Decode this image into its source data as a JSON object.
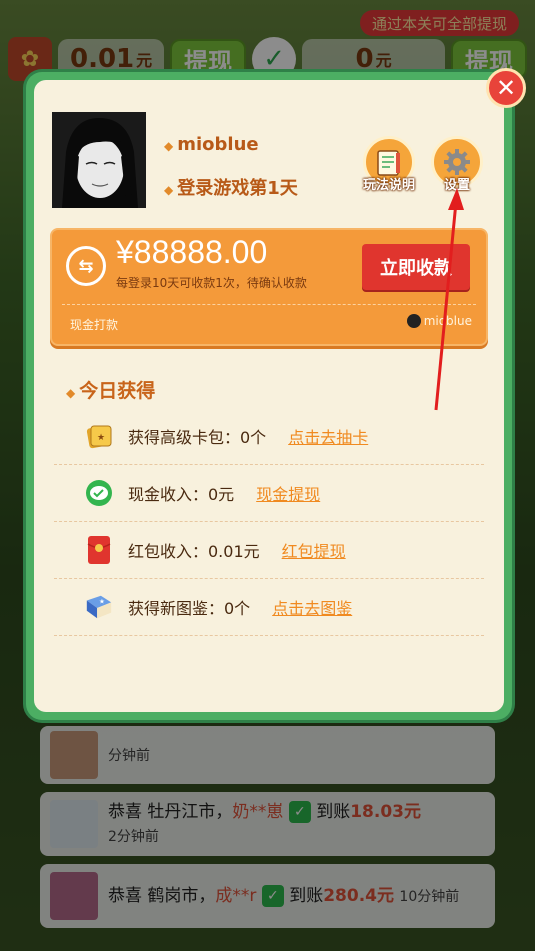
{
  "top_bar": {
    "hint": "通过本关可全部提现",
    "balance1": "0.01",
    "unit1": "元",
    "withdraw1": "提现",
    "balance2": "0",
    "unit2": "元",
    "withdraw2": "提现"
  },
  "profile": {
    "username": "mioblue",
    "login_days": "登录游戏第1天",
    "rules_label": "玩法说明",
    "settings_label": "设置"
  },
  "cash_card": {
    "amount": "¥88888.00",
    "note": "每登录10天可收款1次，待确认收款",
    "collect_label": "立即收款",
    "footer_left": "现金打款",
    "footer_right": "mioblue"
  },
  "today": {
    "title": "今日获得",
    "items": [
      {
        "label": "获得高级卡包：0个",
        "link": "点击去抽卡",
        "icon": "card-pack-icon"
      },
      {
        "label": "现金收入：0元",
        "link": "现金提现",
        "icon": "wechat-icon"
      },
      {
        "label": "红包收入：0.01元",
        "link": "红包提现",
        "icon": "red-envelope-icon"
      },
      {
        "label": "获得新图鉴：0个",
        "link": "点击去图鉴",
        "icon": "book-icon"
      }
    ]
  },
  "feed": [
    {
      "time": "分钟前"
    },
    {
      "prefix": "恭喜",
      "city": "牡丹江市，",
      "user": "奶**崽",
      "action": "到账",
      "amount": "18.03元",
      "time": "2分钟前"
    },
    {
      "prefix": "恭喜",
      "city": "鹤岗市，",
      "user": "成**r",
      "action": "到账",
      "amount": "280.4元",
      "time": "10分钟前"
    }
  ],
  "colors": {
    "modal_border": "#4cae63",
    "panel_bg": "#f8f1dd",
    "cash_card": "#f49a3a",
    "collect_button": "#e0352e",
    "link": "#f08a20",
    "close_button": "#e8433a"
  }
}
